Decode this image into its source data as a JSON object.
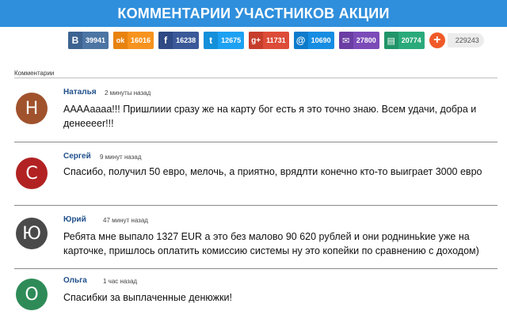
{
  "header": {
    "title": "КОММЕНТАРИИ УЧАСТНИКОВ АКЦИИ"
  },
  "share": {
    "buttons": [
      {
        "network": "vk",
        "icon": "vk-icon",
        "glyph": "B",
        "count": "39941",
        "color": "#4c75a3"
      },
      {
        "network": "odnoklassniki",
        "icon": "odnoklassniki-icon",
        "glyph": "ok",
        "count": "16016",
        "color": "#f7931e"
      },
      {
        "network": "facebook",
        "icon": "facebook-icon",
        "glyph": "f",
        "count": "16238",
        "color": "#3b5998"
      },
      {
        "network": "twitter",
        "icon": "twitter-icon",
        "glyph": "t",
        "count": "12675",
        "color": "#1da1f2"
      },
      {
        "network": "google-plus",
        "icon": "google-plus-icon",
        "glyph": "g+",
        "count": "11731",
        "color": "#dd4b39"
      },
      {
        "network": "mail-ru",
        "icon": "mail-ru-icon",
        "glyph": "@",
        "count": "10690",
        "color": "#168de2"
      },
      {
        "network": "email",
        "icon": "email-icon",
        "glyph": "✉",
        "count": "27800",
        "color": "#7b4bb8"
      },
      {
        "network": "print",
        "icon": "printer-icon",
        "glyph": "▤",
        "count": "20774",
        "color": "#2aaa7a"
      }
    ],
    "plus_label": "+",
    "total": "229243"
  },
  "comments_section": {
    "label": "Комментарии"
  },
  "comments": [
    {
      "initial": "Н",
      "avatar_color": "#a0522d",
      "name": "Наталья",
      "time": "2 минуты назад",
      "text": "ААААаааа!!! Пришлиии сразу же на карту бог есть я это точно знаю. Всем удачи, добра и денееееr!!!"
    },
    {
      "initial": "С",
      "avatar_color": "#b22222",
      "name": "Сергей",
      "time": "9 минут назад",
      "text": "Спасибо, получил 50 евро, мелочь, а приятно, врядлти конечно кто-то выиграет 3000 евро"
    },
    {
      "initial": "Ю",
      "avatar_color": "#4a4a4a",
      "name": "Юрий",
      "time": "47 минут назад",
      "text": "Ребята мне выпало 1327 EUR а это без малово 90 620 рублей и они родниньkие уже на карточке, пришлось оплатить комиссию системы ну это копейки по сравнению с доходом)"
    },
    {
      "initial": "О",
      "avatar_color": "#2e8b57",
      "name": "Ольга",
      "time": "1 час назад",
      "text": "Спасибки за выплаченные денюжки!"
    }
  ]
}
